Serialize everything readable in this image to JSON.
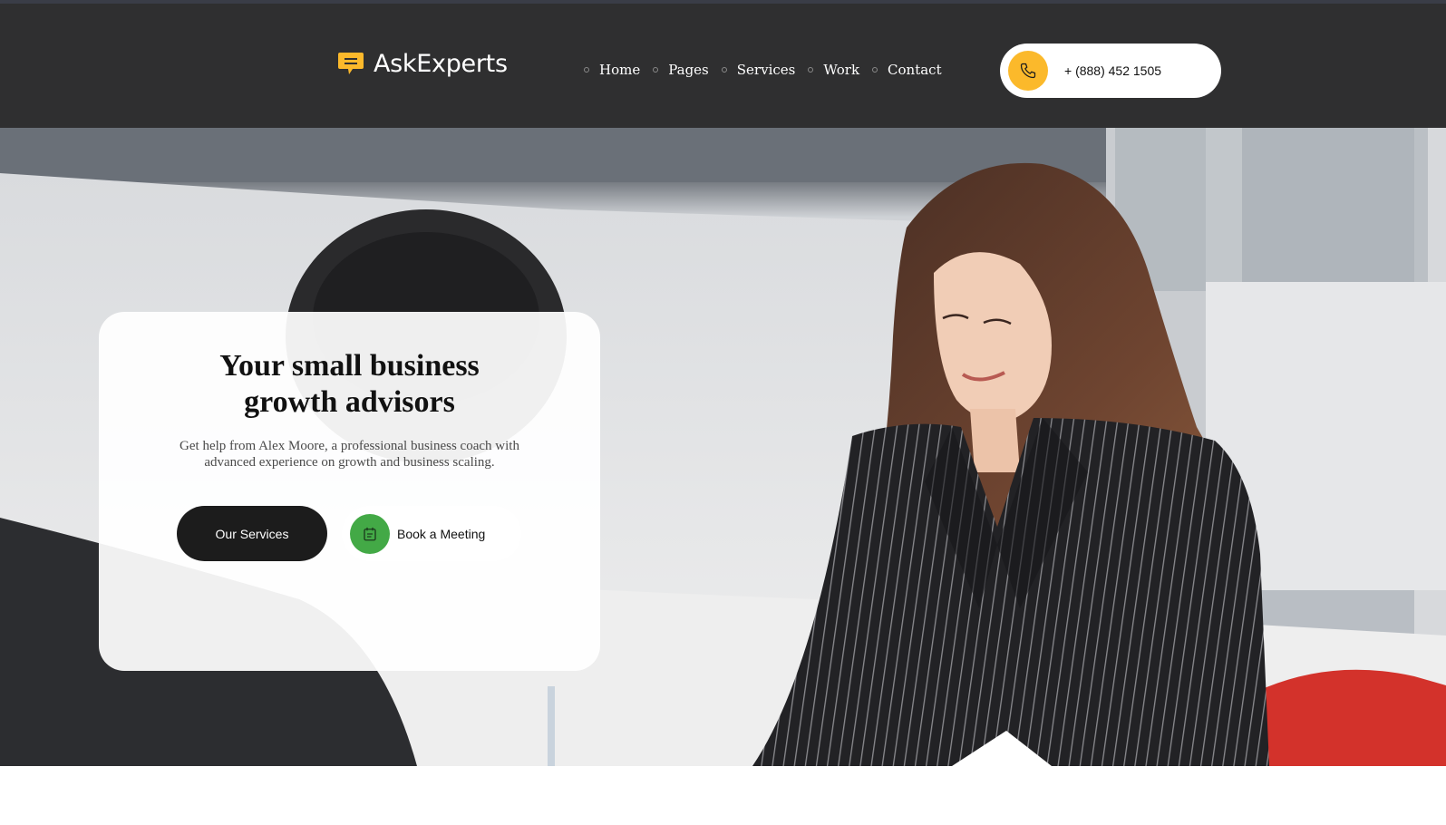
{
  "brand": {
    "name": "AskExperts",
    "logo_icon": "chat-bubble-icon",
    "accent_color": "#fbb92b"
  },
  "nav": {
    "items": [
      {
        "label": "Home"
      },
      {
        "label": "Pages"
      },
      {
        "label": "Services"
      },
      {
        "label": "Work"
      },
      {
        "label": "Contact"
      }
    ]
  },
  "contact": {
    "phone": "+ (888) 452 1505",
    "icon": "phone-icon"
  },
  "hero": {
    "title_line1": "Your small business",
    "title_line2": "growth advisors",
    "subtitle": "Get help from Alex Moore, a professional business coach with advanced experience on growth and business scaling.",
    "primary_button": "Our Services",
    "secondary_button": "Book a Meeting",
    "secondary_icon": "calendar-icon",
    "secondary_icon_color": "#43a946",
    "primary_button_color": "#1c1c1c",
    "photo": "business-meeting-photo"
  }
}
